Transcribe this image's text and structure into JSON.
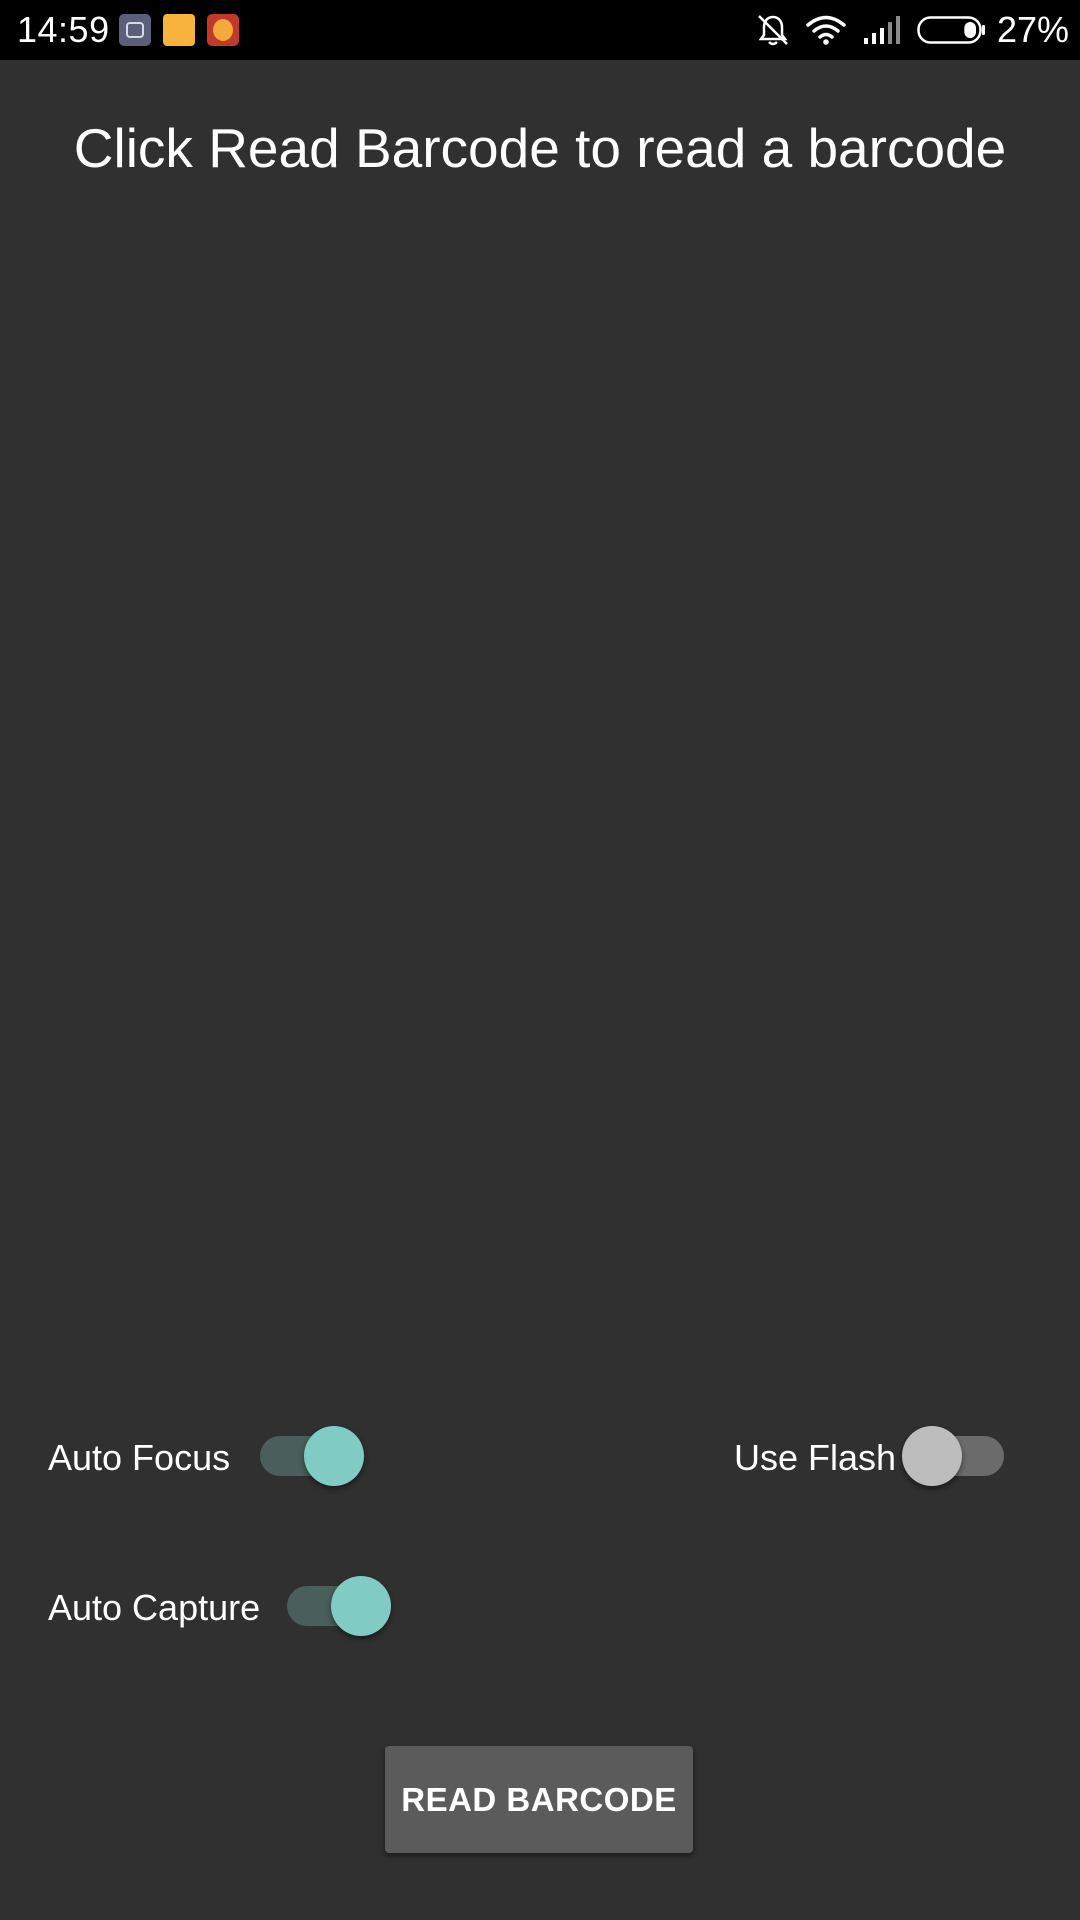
{
  "status_bar": {
    "time": "14:59",
    "battery_percent": "27%",
    "battery_level": 0.27,
    "icons": [
      "screenshot-app-icon",
      "files-app-icon",
      "game-app-icon",
      "bell-muted-icon",
      "wifi-icon",
      "cell-signal-icon",
      "battery-icon"
    ]
  },
  "main": {
    "heading": "Click Read Barcode to read a barcode"
  },
  "settings": {
    "auto_focus": {
      "label": "Auto Focus",
      "checked": true
    },
    "use_flash": {
      "label": "Use Flash",
      "checked": false
    },
    "auto_capture": {
      "label": "Auto Capture",
      "checked": true
    }
  },
  "actions": {
    "read_barcode_label": "READ BARCODE"
  },
  "colors": {
    "background": "#303030",
    "status_bar": "#000000",
    "switch_on_thumb": "#80cbc4",
    "switch_on_track": "#4a5e5b",
    "switch_off_thumb": "#bdbdbd",
    "switch_off_track": "#6b6b6b",
    "button": "#5b5b5c"
  }
}
